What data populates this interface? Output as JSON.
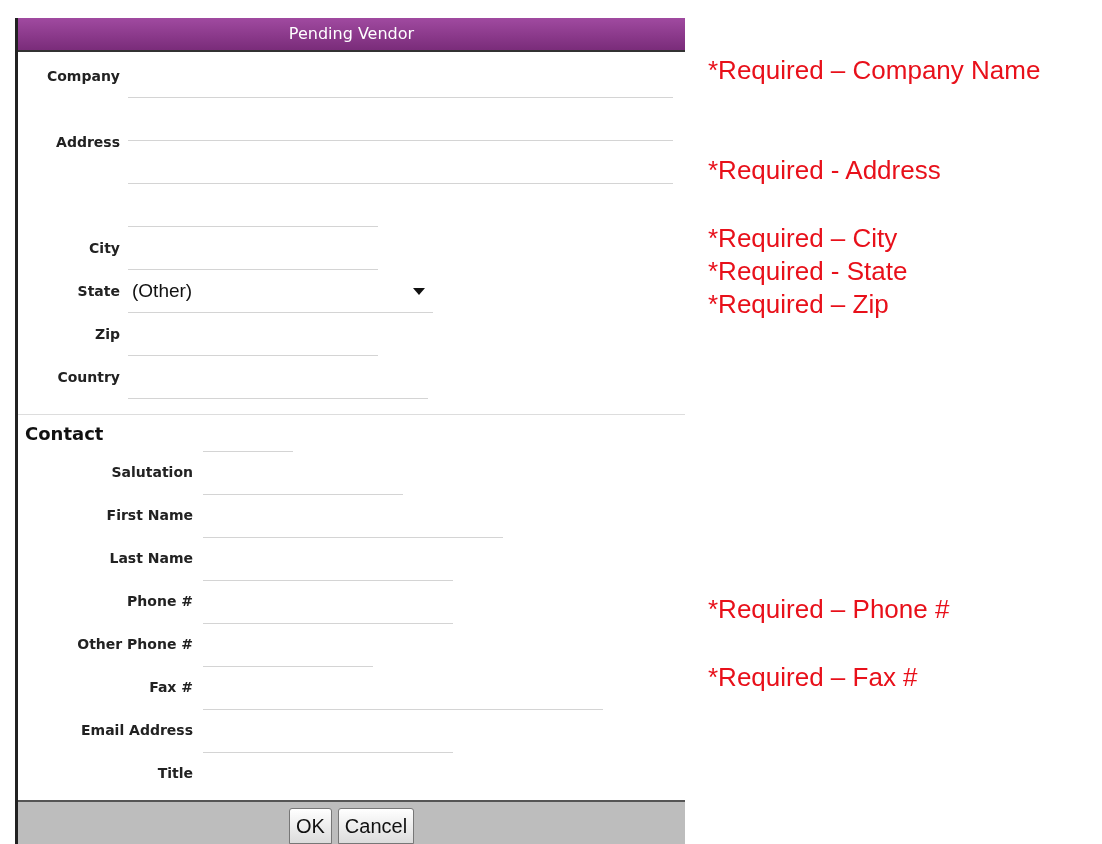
{
  "window": {
    "title": "Pending Vendor"
  },
  "address_fields": [
    {
      "label": "Company",
      "kind": "text"
    },
    {
      "label": "Address",
      "kind": "multiline"
    },
    {
      "label": "City",
      "kind": "text"
    },
    {
      "label": "State",
      "kind": "select",
      "value": "(Other)"
    },
    {
      "label": "Zip",
      "kind": "text"
    },
    {
      "label": "Country",
      "kind": "text"
    }
  ],
  "contact": {
    "heading": "Contact",
    "fields": [
      {
        "label": "Salutation"
      },
      {
        "label": "First Name"
      },
      {
        "label": "Last Name"
      },
      {
        "label": "Phone #"
      },
      {
        "label": "Other Phone #"
      },
      {
        "label": "Fax #"
      },
      {
        "label": "Email Address"
      },
      {
        "label": "Title"
      }
    ]
  },
  "buttons": [
    "OK",
    "Cancel"
  ],
  "annotations": [
    "*Required – Company Name",
    "*Required - Address",
    "*Required – City",
    "*Required - State",
    "*Required – Zip",
    "*Required – Phone #",
    "*Required – Fax #"
  ]
}
